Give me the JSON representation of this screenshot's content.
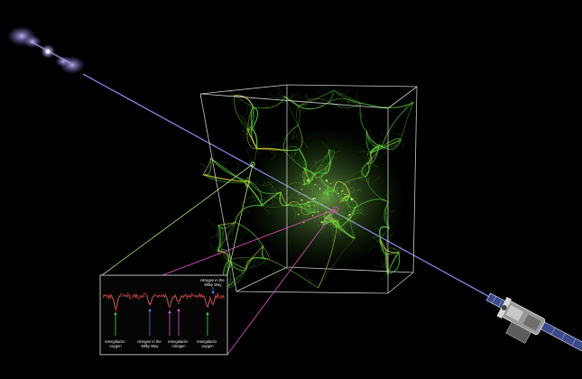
{
  "colors": {
    "background": "#000000",
    "sightline": "#8f86f0",
    "quasar_glow": "#9b8ad8",
    "cube_edge": "#e6e6e6",
    "filament_green": "#5fd23a",
    "filament_yellow": "#d6d23a",
    "zoom_green": "#a6e07a",
    "zoom_magenta": "#e052c8",
    "spectrum_line": "#d23232",
    "arrow_green": "#3fd24a",
    "arrow_magenta": "#e052c8",
    "arrow_blue": "#5a78e0"
  },
  "icons": {
    "quasar": "quasar-icon",
    "telescope": "xray-telescope-icon"
  },
  "spectrum": {
    "labels": [
      {
        "lines": [
          "intergalactic",
          "oxygen"
        ],
        "color": "arrow_green"
      },
      {
        "lines": [
          "nitrogen in the",
          "Milky Way"
        ],
        "color": "arrow_blue"
      },
      {
        "lines": [
          "intergalactic",
          "nitrogen"
        ],
        "color": "arrow_magenta"
      },
      {
        "lines": [
          "intergalactic",
          "oxygen"
        ],
        "color": "arrow_green"
      },
      {
        "lines": [
          "nitrogen in the",
          "Milky Way"
        ],
        "color": "arrow_blue"
      }
    ]
  }
}
